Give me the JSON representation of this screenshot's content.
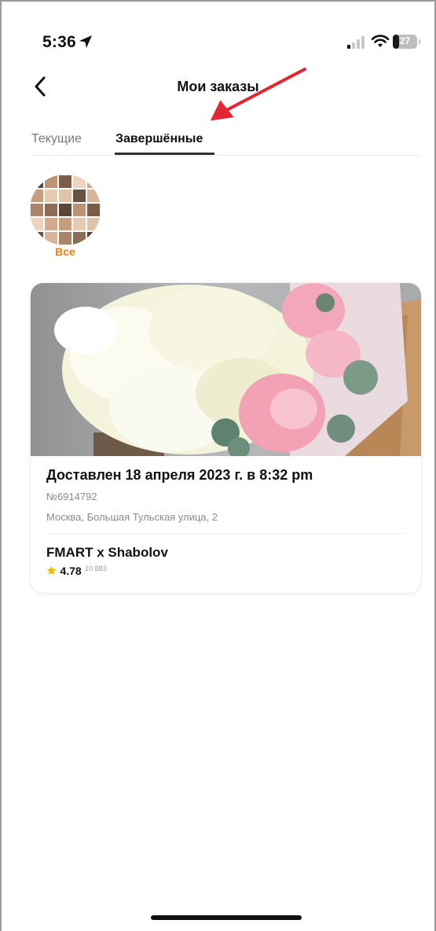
{
  "status_bar": {
    "time": "5:36",
    "battery_percent": "27",
    "battery_level": 0.27,
    "icons": [
      "location-arrow-icon",
      "signal-icon",
      "wifi-icon",
      "battery-icon"
    ]
  },
  "nav": {
    "title": "Мои заказы",
    "back_icon": "chevron-left-icon"
  },
  "tabs": [
    {
      "label": "Текущие",
      "active": false
    },
    {
      "label": "Завершённые",
      "active": true
    }
  ],
  "filter": {
    "all_label": "Все"
  },
  "order": {
    "status_text": "Доставлен 18 апреля 2023 г. в 8:32 pm",
    "number": "№6914792",
    "address": "Москва, Большая Тульская улица, 2",
    "shop_name": "FMART x Shabolov",
    "rating": "4.78",
    "reviews_count": "10 883"
  },
  "colors": {
    "accent_orange": "#f07a14",
    "star": "#f5b400",
    "annotation_arrow": "#e3262f"
  }
}
